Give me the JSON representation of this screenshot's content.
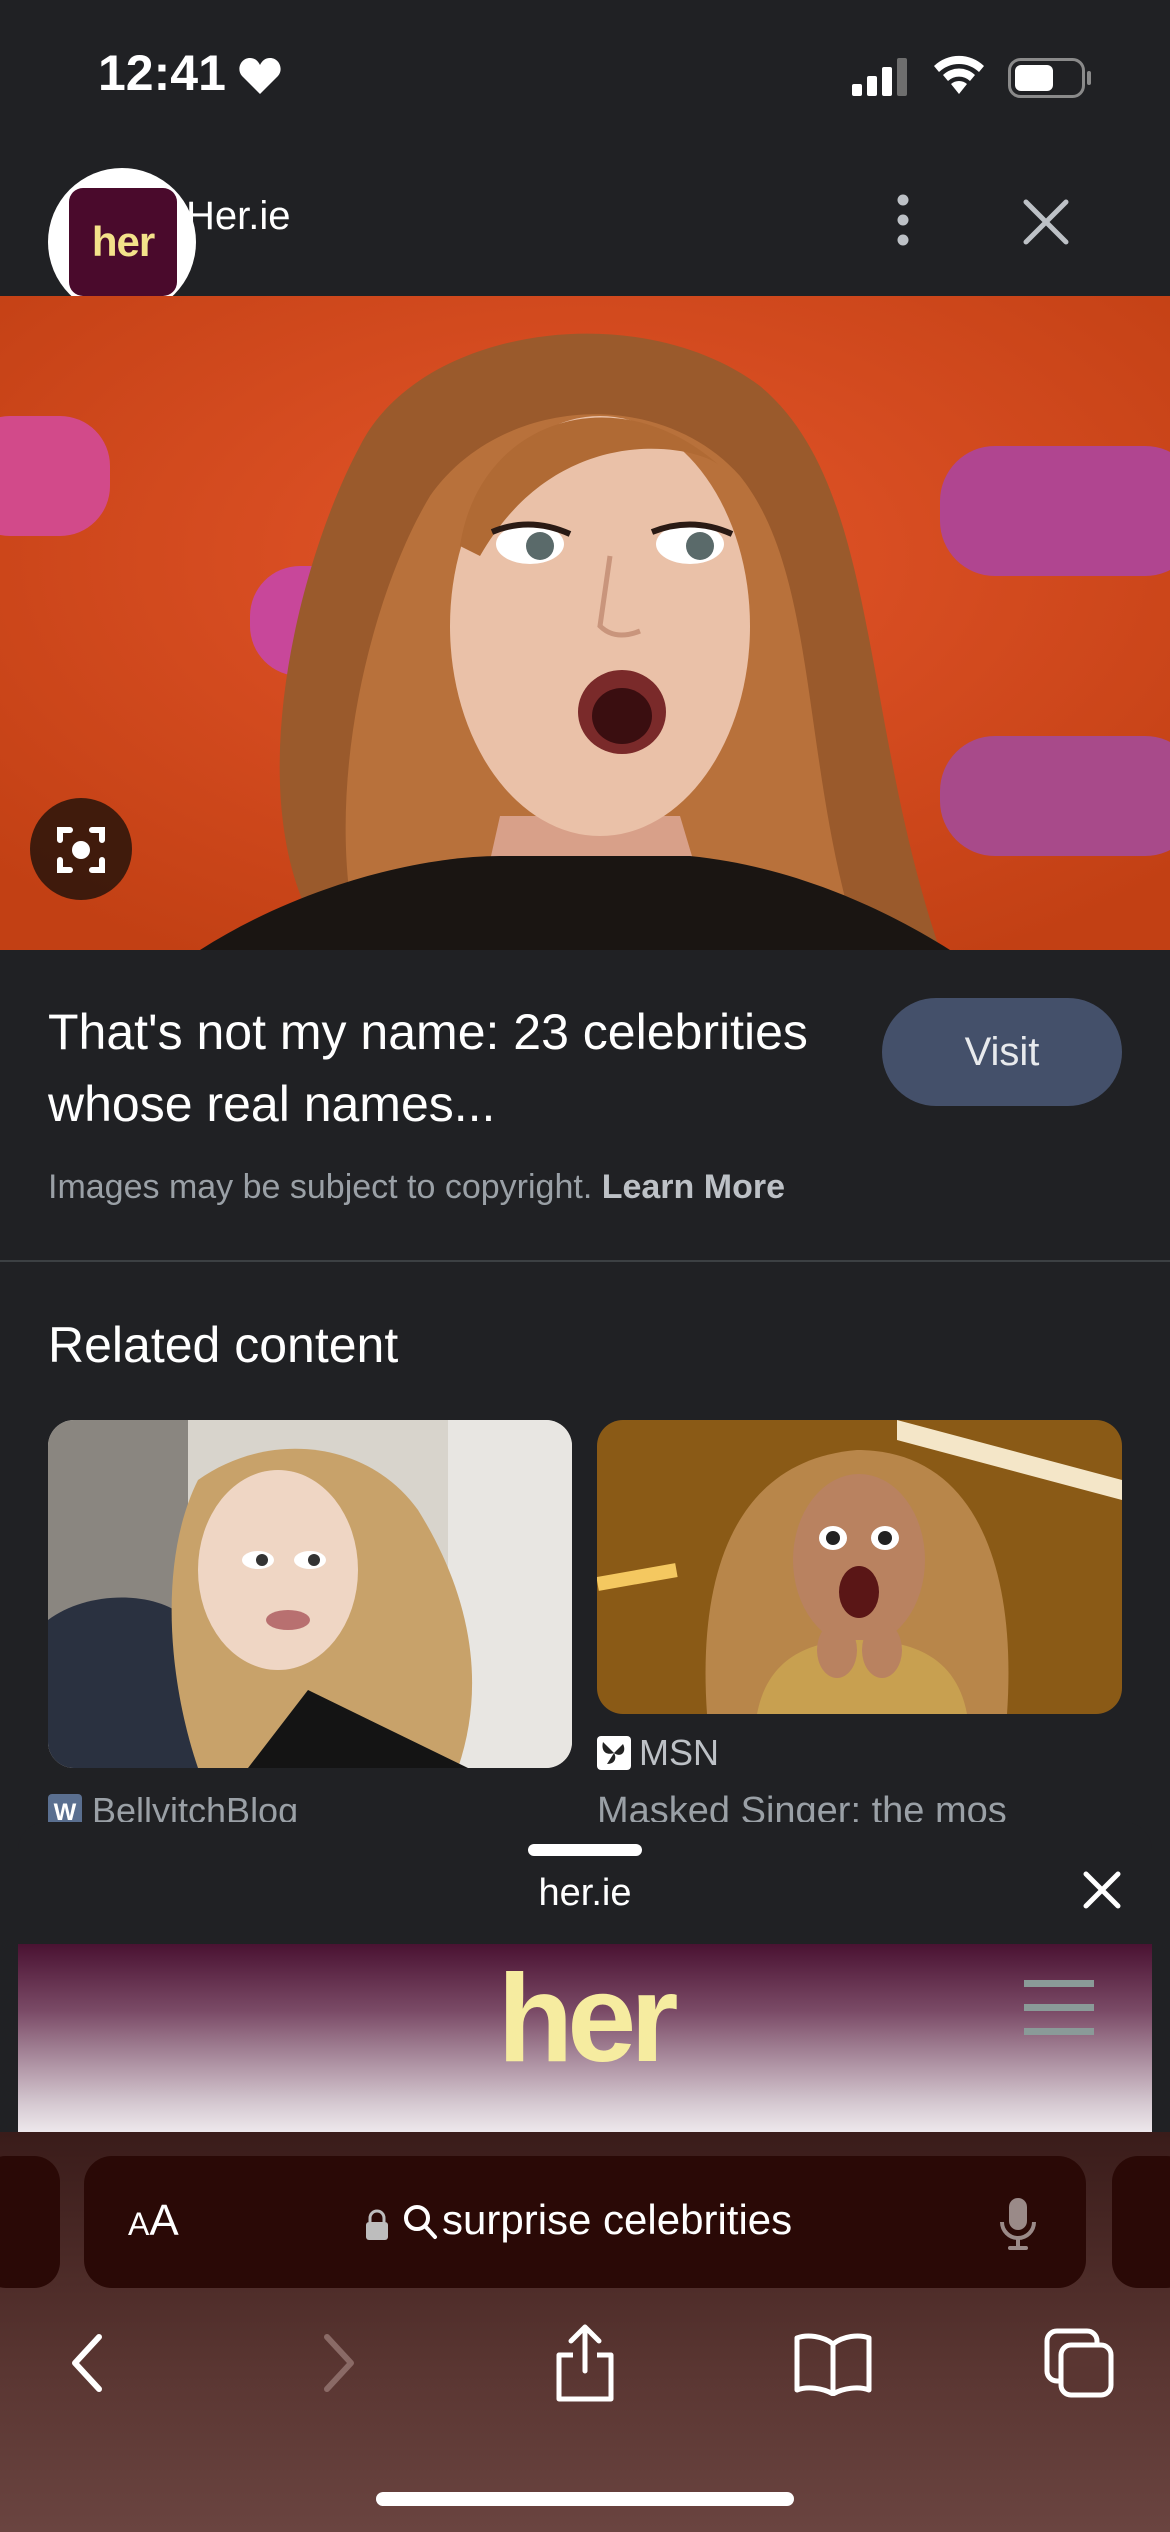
{
  "status_bar": {
    "time": "12:41"
  },
  "header": {
    "source_name": "Her.ie",
    "logo_text": "her"
  },
  "result": {
    "title": "That's not my name: 23 celebrities whose real names...",
    "visit_label": "Visit",
    "copyright": "Images may be subject to copyright.",
    "learn_more": "Learn More"
  },
  "related": {
    "heading": "Related content",
    "items": [
      {
        "source": "BellyitchBlog",
        "title": ""
      },
      {
        "source": "MSN",
        "title": "Masked Singer: the mos"
      }
    ]
  },
  "sheet": {
    "domain": "her.ie",
    "site_logo": "her"
  },
  "safari": {
    "aa_label_big": "A",
    "aa_label_small": "A",
    "address": "surprise celebrities"
  },
  "colors": {
    "visit_bg": "#44506a",
    "her_brand": "#4a0a2c",
    "her_yellow": "#f4e28a"
  },
  "icons": [
    "heart-icon",
    "signal-icon",
    "wifi-icon",
    "battery-icon",
    "more-vert-icon",
    "close-icon",
    "lens-icon",
    "lock-icon",
    "search-icon",
    "mic-icon",
    "back-icon",
    "forward-icon",
    "share-icon",
    "bookmarks-icon",
    "tabs-icon"
  ]
}
